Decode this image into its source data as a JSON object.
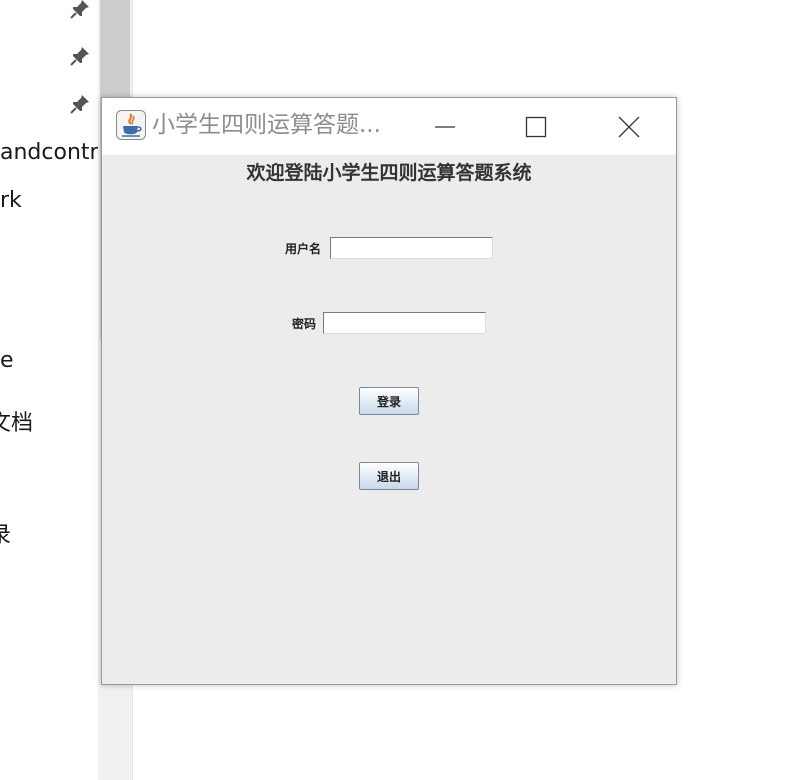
{
  "background": {
    "items": [
      "andcontr",
      "rk",
      "e",
      "文档",
      "录"
    ]
  },
  "window": {
    "title": "小学生四则运算答题...",
    "heading": "欢迎登陆小学生四则运算答题系统",
    "form": {
      "username_label": "用户名",
      "username_value": "",
      "password_label": "密码",
      "password_value": ""
    },
    "buttons": {
      "login": "登录",
      "exit": "退出"
    }
  }
}
